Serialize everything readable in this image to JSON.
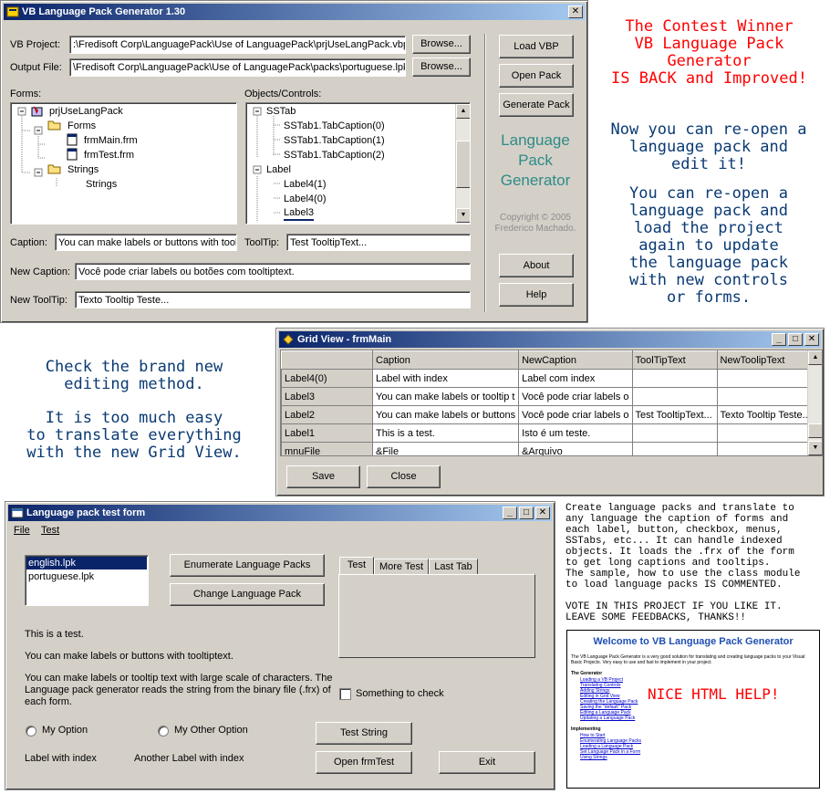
{
  "main_window": {
    "title": "VB Language Pack Generator 1.30",
    "vb_project_label": "VB Project:",
    "vb_project_value": ":\\Fredisoft Corp\\LanguagePack\\Use of LanguagePack\\prjUseLangPack.vbp",
    "output_file_label": "Output File:",
    "output_file_value": "\\Fredisoft Corp\\LanguagePack\\Use of LanguagePack\\packs\\portuguese.lpk",
    "browse_label": "Browse...",
    "forms_label": "Forms:",
    "objects_label": "Objects/Controls:",
    "forms_tree": [
      "prjUseLangPack",
      "Forms",
      "frmMain.frm",
      "frmTest.frm",
      "Strings",
      "Strings"
    ],
    "objects_tree": [
      "SSTab",
      "SSTab1.TabCaption(0)",
      "SSTab1.TabCaption(1)",
      "SSTab1.TabCaption(2)",
      "Label",
      "Label4(1)",
      "Label4(0)",
      "Label3"
    ],
    "caption_label": "Caption:",
    "caption_value": "You can make labels or buttons with toolti",
    "tooltip_label": "ToolTip:",
    "tooltip_value": "Test TooltipText...",
    "new_caption_label": "New Caption:",
    "new_caption_value": "Você pode criar labels ou botões com tooltiptext.",
    "new_tooltip_label": "New ToolTip:",
    "new_tooltip_value": "Texto Tooltip Teste...",
    "buttons": {
      "load_vbp": "Load VBP",
      "open_pack": "Open Pack",
      "generate_pack": "Generate Pack",
      "about": "About",
      "help": "Help"
    },
    "logo_text": [
      "Language",
      "Pack",
      "Generator"
    ],
    "copyright": [
      "Copyright © 2005",
      "Frederico Machado."
    ]
  },
  "promo_top": {
    "red_lines": [
      "The Contest Winner",
      "VB Language Pack",
      "Generator",
      "IS BACK and Improved!"
    ],
    "blue_lines_1": [
      "Now you can re-open a",
      "language pack and",
      "edit it!"
    ],
    "blue_lines_2": [
      "You can re-open a",
      "language pack and",
      "load the project",
      "again to update",
      "the language pack",
      "with new controls",
      "or forms."
    ]
  },
  "promo_mid": {
    "lines_1": [
      "Check the brand new",
      "editing method."
    ],
    "lines_2": [
      "It is too much easy",
      "to translate everything",
      "with the new Grid View."
    ]
  },
  "grid_window": {
    "title": "Grid View - frmMain",
    "columns": [
      "Caption",
      "NewCaption",
      "ToolTipText",
      "NewToolipText"
    ],
    "rows": [
      {
        "name": "Label4(0)",
        "caption": "Label with index",
        "new_caption": "Label com index",
        "tooltip": "",
        "new_tooltip": ""
      },
      {
        "name": "Label3",
        "caption": "You can make labels or tooltip t",
        "new_caption": "Você pode criar labels o",
        "tooltip": "",
        "new_tooltip": ""
      },
      {
        "name": "Label2",
        "caption": "You can make labels or buttons",
        "new_caption": "Você pode criar labels o",
        "tooltip": "Test TooltipText...",
        "new_tooltip": "Texto Tooltip Teste..."
      },
      {
        "name": "Label1",
        "caption": "This is a test.",
        "new_caption": "Isto é um teste.",
        "tooltip": "",
        "new_tooltip": ""
      },
      {
        "name": "mnuFile",
        "caption": "&File",
        "new_caption": "&Arquivo",
        "tooltip": "",
        "new_tooltip": ""
      }
    ],
    "save_label": "Save",
    "close_label": "Close"
  },
  "test_window": {
    "title": "Language pack test form",
    "menu": [
      "File",
      "Test"
    ],
    "list_items": [
      "english.lpk",
      "portuguese.lpk"
    ],
    "enumerate_button": "Enumerate Language Packs",
    "change_button": "Change Language Pack",
    "tabs": [
      "Test",
      "More Test",
      "Last Tab"
    ],
    "label_test": "This is a test.",
    "label_tooltip": "You can make labels or buttons with tooltiptext.",
    "label_long": [
      "You can make labels or tooltip text with large scale of characters. The",
      "Language pack generator reads the string from the binary file (.frx) of",
      "each form."
    ],
    "checkbox_label": "Something to check",
    "option_1": "My Option",
    "option_2": "My Other Option",
    "test_string_button": "Test String",
    "label_index": "Label with index",
    "label_another_index": "Another Label with index",
    "open_frmtest_button": "Open frmTest",
    "exit_button": "Exit"
  },
  "description": {
    "lines": [
      "Create language packs and translate to",
      "any language the caption of forms and",
      "each label, button, checkbox, menus,",
      "SSTabs, etc... It can handle indexed",
      "objects. It loads the .frx of the form",
      "to get long captions and tooltips.",
      "The sample, how to use the class module",
      "to load language packs IS COMMENTED."
    ],
    "vote_lines": [
      "VOTE IN THIS PROJECT IF YOU LIKE IT.",
      "LEAVE SOME FEEDBACKS, THANKS!!"
    ]
  },
  "help_preview": {
    "title": "Welcome to VB Language Pack Generator",
    "intro": "The VB Language Pack Generator is a very good solution for translating and creating language packs to your Visual Basic Projects. Very easy to use and fast to implement in your project.",
    "section_1": "The Generator",
    "items_1": [
      "Loading a VB Project",
      "Translating Controls",
      "Adding Strings",
      "Editing in Grid View",
      "Creating the Language Pack",
      "Saving the \"default\" Pack",
      "Editing a Language Pack",
      "Updating a Language Pack"
    ],
    "section_2": "Implementing",
    "items_2": [
      "How to Start",
      "Enumerating Language Packs",
      "Loading a Language Pack",
      "Set Language Pack in a Form",
      "Using Strings"
    ],
    "nice_label": "NICE HTML HELP!"
  }
}
